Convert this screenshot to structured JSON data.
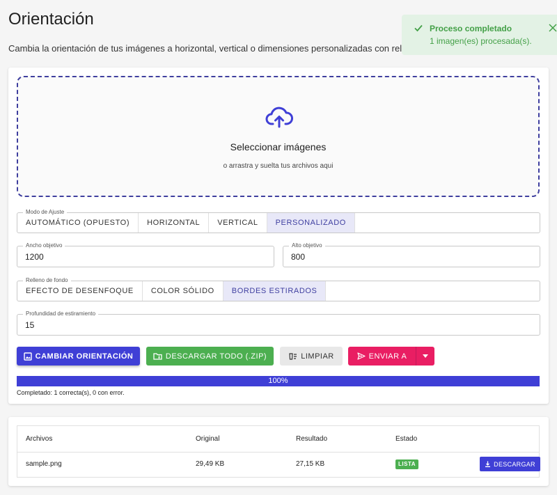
{
  "page": {
    "title": "Orientación",
    "description": "Cambia la orientación de tus imágenes a horizontal, vertical o dimensiones personalizadas con relle"
  },
  "toast": {
    "title": "Proceso completado",
    "body": "1 imagen(es) procesada(s).",
    "color": "#43a047"
  },
  "dropzone": {
    "title": "Seleccionar imágenes",
    "subtitle": "o arrastra y suelta tus archivos aqui"
  },
  "fit_mode": {
    "label": "Modo de Ajuste",
    "options": [
      "AUTOMÁTICO (OPUESTO)",
      "HORIZONTAL",
      "VERTICAL",
      "PERSONALIZADO"
    ],
    "selected": "PERSONALIZADO"
  },
  "target_width": {
    "label": "Ancho objetivo",
    "value": "1200"
  },
  "target_height": {
    "label": "Alto objetivo",
    "value": "800"
  },
  "background_fill": {
    "label": "Relleno de fondo",
    "options": [
      "EFECTO DE DESENFOQUE",
      "COLOR SÓLIDO",
      "BORDES ESTIRADOS"
    ],
    "selected": "BORDES ESTIRADOS"
  },
  "stretch_depth": {
    "label": "Profundidad de estiramiento",
    "value": "15"
  },
  "actions": {
    "change_orientation": "CAMBIAR ORIENTACIÓN",
    "download_all": "DESCARGAR TODO (.ZIP)",
    "clear": "LIMPIAR",
    "send_to": "ENVIAR A"
  },
  "progress": {
    "value": 100,
    "label": "100%",
    "status": "Completado: 1 correcta(s), 0 con error."
  },
  "files_table": {
    "headers": [
      "Archivos",
      "Original",
      "Resultado",
      "Estado"
    ],
    "rows": [
      {
        "name": "sample.png",
        "original": "29,49 KB",
        "result": "27,15 KB",
        "status": "LISTA",
        "action": "DESCARGAR"
      }
    ]
  },
  "colors": {
    "primary": "#3f3fd6",
    "success": "#4caf50",
    "accent": "#e91e63"
  }
}
